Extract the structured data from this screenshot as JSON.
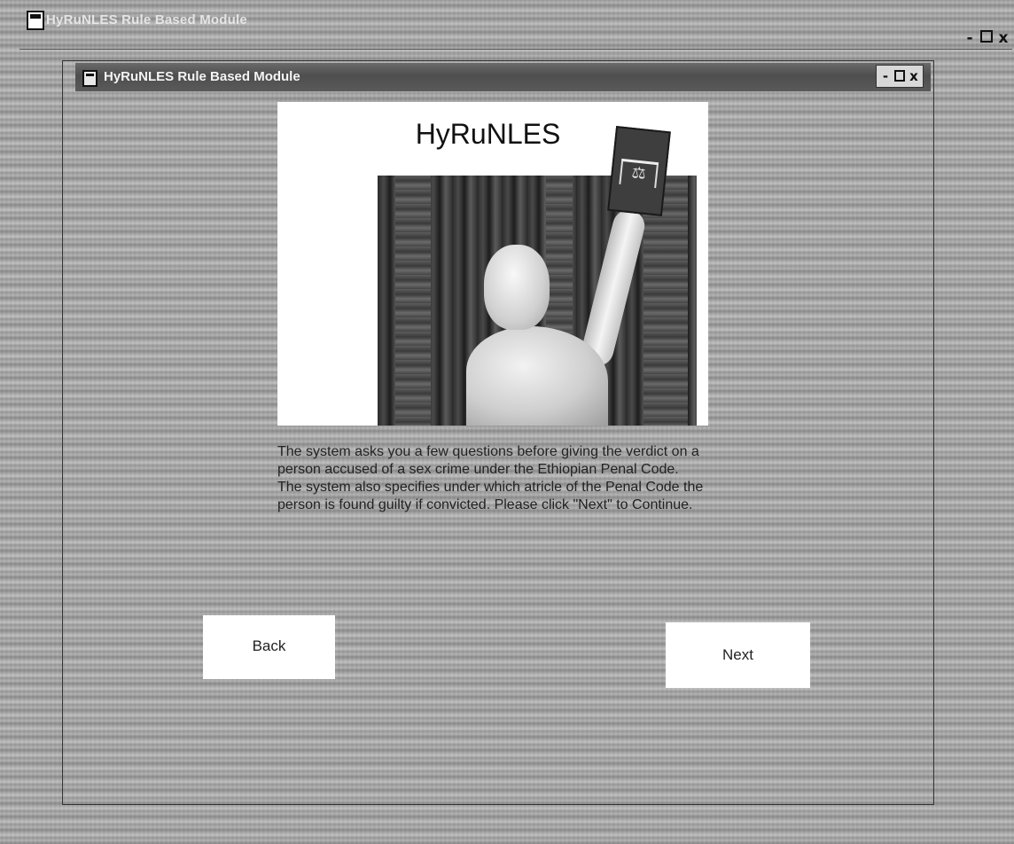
{
  "outer_window": {
    "title": "HyRuNLES Rule Based Module",
    "controls": {
      "minimize": "-",
      "close": "x"
    }
  },
  "inner_window": {
    "title": "HyRuNLES Rule Based Module",
    "controls": {
      "minimize": "-",
      "close": "x"
    }
  },
  "splash": {
    "title": "HyRuNLES",
    "scales_glyph": "⚖"
  },
  "description": {
    "paragraph1": "The system asks you a few questions before giving the verdict on a person accused of a sex crime under the  Ethiopian Penal Code.",
    "paragraph2": "The system also specifies under which atricle of the Penal Code the person is found guilty if convicted. Please click \"Next\" to Continue."
  },
  "buttons": {
    "back": "Back",
    "next": "Next"
  }
}
